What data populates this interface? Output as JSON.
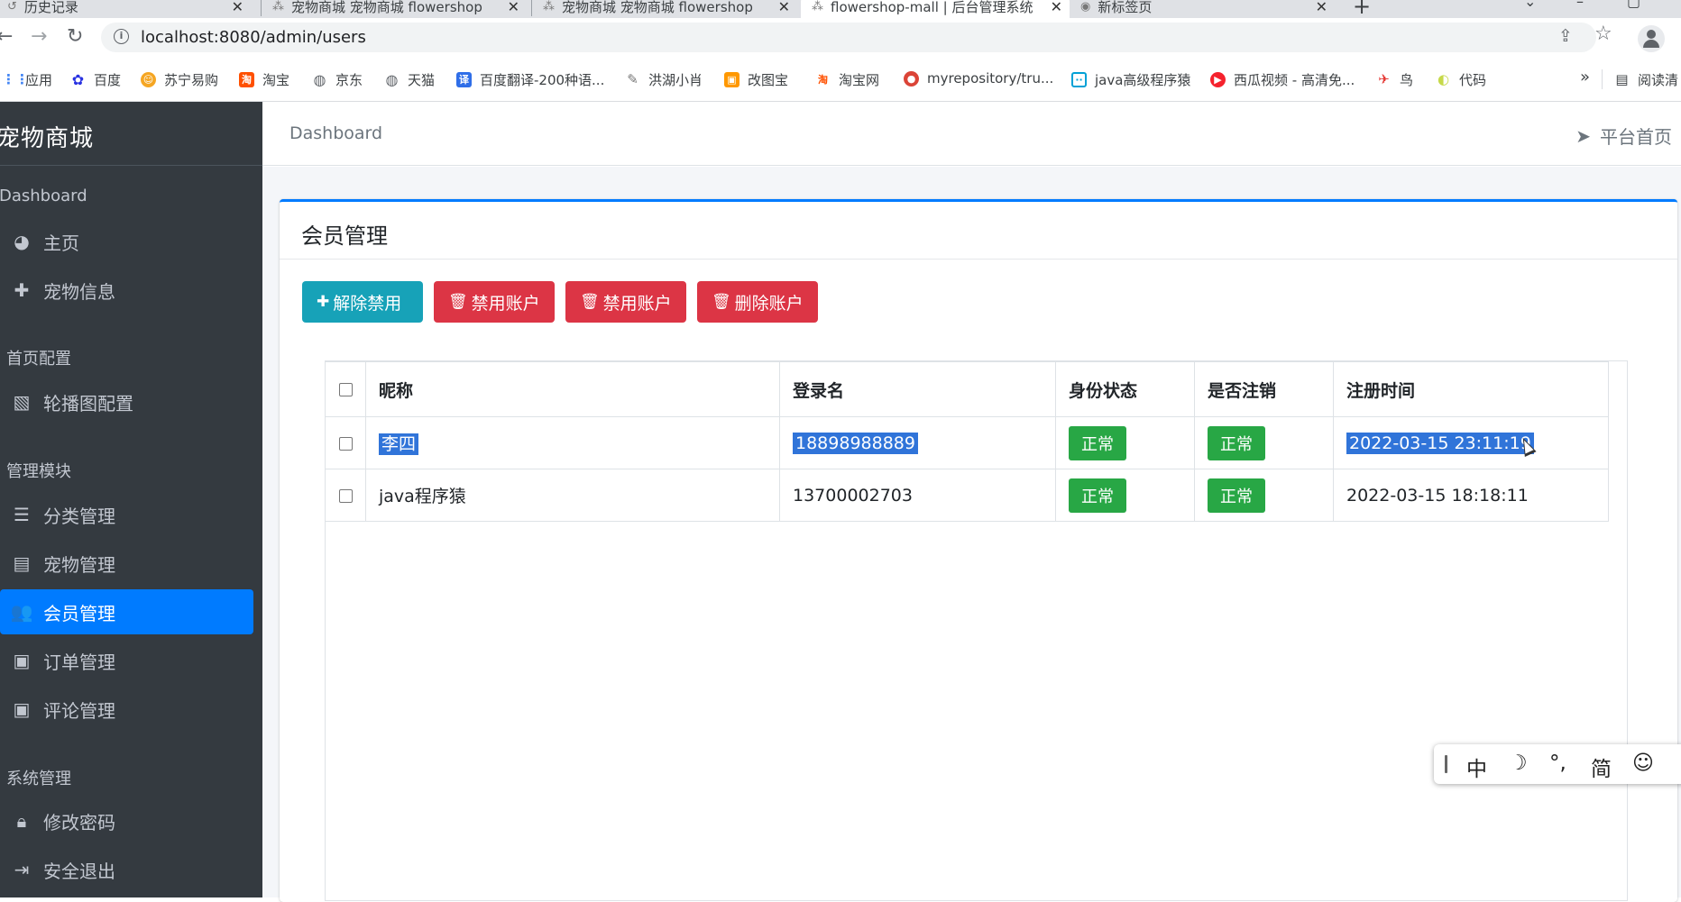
{
  "browser": {
    "tabs": [
      {
        "title": "历史记录",
        "icon": "history-icon"
      },
      {
        "title": "宠物商城 宠物商城 flowershop",
        "icon": "grid-favicon"
      },
      {
        "title": "宠物商城 宠物商城 flowershop",
        "icon": "grid-favicon"
      },
      {
        "title": "flowershop-mall | 后台管理系统",
        "icon": "grid-favicon",
        "active": true
      },
      {
        "title": "新标签页",
        "icon": "chrome-icon"
      }
    ],
    "url": "localhost:8080/admin/users",
    "bookmarks": [
      {
        "label": "应用",
        "color": "#4285f4"
      },
      {
        "label": "百度",
        "color": "#2932e1"
      },
      {
        "label": "苏宁易购",
        "color": "#f5a623"
      },
      {
        "label": "淘宝",
        "color": "#ff5000"
      },
      {
        "label": "京东",
        "color": "#5f6368"
      },
      {
        "label": "天猫",
        "color": "#5f6368"
      },
      {
        "label": "百度翻译-200种语...",
        "color": "#2f6ee8"
      },
      {
        "label": "洪湖小肖",
        "color": "#888888"
      },
      {
        "label": "改图宝",
        "color": "#ff9800"
      },
      {
        "label": "淘宝网",
        "color": "#ff5000"
      },
      {
        "label": "myrepository/tru...",
        "color": "#db4437"
      },
      {
        "label": "java高级程序猿",
        "color": "#00a1d6"
      },
      {
        "label": "西瓜视频 - 高清免...",
        "color": "#f5222d"
      },
      {
        "label": "鸟",
        "color": "#e53935"
      },
      {
        "label": "代码",
        "color": "#c6d94a"
      }
    ],
    "reading_list": "阅读清"
  },
  "sidebar": {
    "brand": "宠物商城",
    "sections": [
      {
        "header": "Dashboard",
        "items": [
          {
            "label": "主页",
            "icon": "dashboard-icon"
          },
          {
            "label": "宠物信息",
            "icon": "plus-icon"
          }
        ]
      },
      {
        "header": "首页配置",
        "items": [
          {
            "label": "轮播图配置",
            "icon": "image-icon"
          }
        ]
      },
      {
        "header": "管理模块",
        "items": [
          {
            "label": "分类管理",
            "icon": "list-icon"
          },
          {
            "label": "宠物管理",
            "icon": "archive-icon"
          },
          {
            "label": "会员管理",
            "icon": "users-icon",
            "active": true
          },
          {
            "label": "订单管理",
            "icon": "money-icon"
          },
          {
            "label": "评论管理",
            "icon": "money-icon"
          }
        ]
      },
      {
        "header": "系统管理",
        "items": [
          {
            "label": "修改密码",
            "icon": "lock-icon"
          },
          {
            "label": "安全退出",
            "icon": "sign-out-icon"
          }
        ]
      }
    ]
  },
  "topnav": {
    "breadcrumb": "Dashboard",
    "home_link": "平台首页"
  },
  "main": {
    "title": "会员管理",
    "buttons": [
      {
        "label": "解除禁用",
        "icon": "plus-icon",
        "style": "info"
      },
      {
        "label": "禁用账户",
        "icon": "trash-icon",
        "style": "danger"
      },
      {
        "label": "禁用账户",
        "icon": "trash-icon",
        "style": "danger"
      },
      {
        "label": "删除账户",
        "icon": "trash-icon",
        "style": "danger"
      }
    ],
    "table": {
      "headers": [
        "昵称",
        "登录名",
        "身份状态",
        "是否注销",
        "注册时间"
      ],
      "rows": [
        {
          "nickname": "李四",
          "login": "18898988889",
          "status": "正常",
          "cancelled": "正常",
          "registered": "2022-03-15 23:11:19",
          "selected": true
        },
        {
          "nickname": "java程序猿",
          "login": "13700002703",
          "status": "正常",
          "cancelled": "正常",
          "registered": "2022-03-15 18:18:11",
          "selected": false
        }
      ]
    }
  },
  "ime": {
    "items": [
      "中",
      "☽",
      "°,",
      "简",
      "☺"
    ]
  },
  "colors": {
    "sidebar_bg": "#343a40",
    "active_blue": "#007bff",
    "info": "#17a2b8",
    "danger": "#dc3545",
    "success": "#28a745"
  }
}
